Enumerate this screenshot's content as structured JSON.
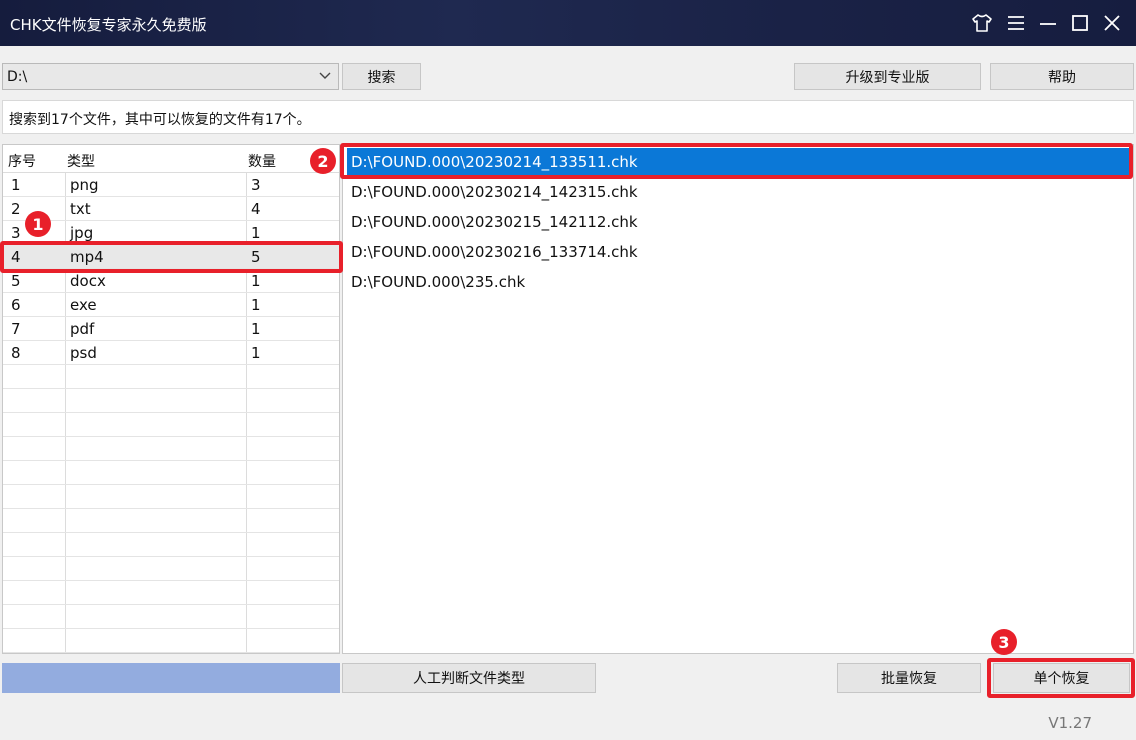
{
  "window": {
    "title": "CHK文件恢复专家永久免费版"
  },
  "window_controls": [
    {
      "name": "skin-icon"
    },
    {
      "name": "menu-icon"
    },
    {
      "name": "minimize-icon"
    },
    {
      "name": "maximize-icon"
    },
    {
      "name": "close-icon"
    }
  ],
  "toolbar": {
    "drive_value": "D:\\",
    "search_label": "搜索",
    "upgrade_label": "升级到专业版",
    "help_label": "帮助"
  },
  "status_text": "搜索到17个文件，其中可以恢复的文件有17个。",
  "type_table": {
    "headers": [
      "序号",
      "类型",
      "数量"
    ],
    "rows": [
      [
        "1",
        "png",
        "3"
      ],
      [
        "2",
        "txt",
        "4"
      ],
      [
        "3",
        "jpg",
        "1"
      ],
      [
        "4",
        "mp4",
        "5"
      ],
      [
        "5",
        "docx",
        "1"
      ],
      [
        "6",
        "exe",
        "1"
      ],
      [
        "7",
        "pdf",
        "1"
      ],
      [
        "8",
        "psd",
        "1"
      ]
    ],
    "selected_index": 3
  },
  "files": [
    "D:\\FOUND.000\\20230214_133511.chk",
    "D:\\FOUND.000\\20230214_142315.chk",
    "D:\\FOUND.000\\20230215_142112.chk",
    "D:\\FOUND.000\\20230216_133714.chk",
    "D:\\FOUND.000\\235.chk"
  ],
  "selected_file_index": 0,
  "bottom": {
    "manual_label": "人工判断文件类型",
    "batch_label": "批量恢复",
    "single_label": "单个恢复"
  },
  "badges": [
    "1",
    "2",
    "3"
  ],
  "version": "V1.27",
  "colors": {
    "highlight": "#e8202a",
    "selection": "#0b78d7",
    "progress": "#93acdf"
  }
}
